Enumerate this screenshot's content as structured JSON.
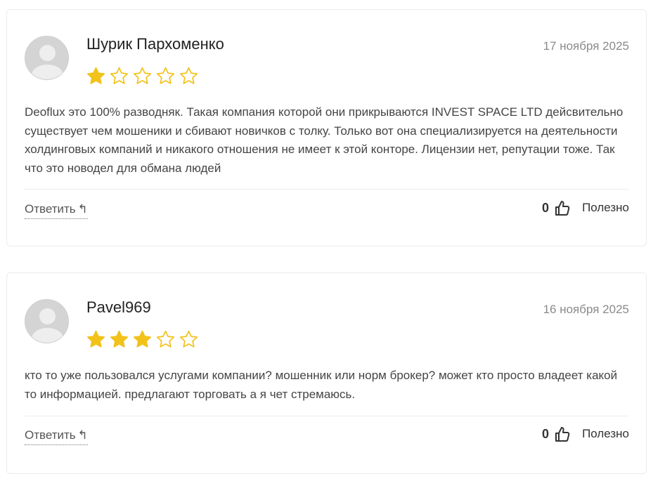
{
  "colors": {
    "star_filled": "#f2c21b",
    "star_outline": "#f2c21b",
    "border": "#ebebeb",
    "date": "#8a8a8a"
  },
  "icons": {
    "avatar": "user-placeholder-icon",
    "star": "star-icon",
    "reply": "reply-arrow-icon",
    "thumb": "thumbs-up-icon"
  },
  "reviews": [
    {
      "author": "Шурик Пархоменко",
      "date": "17 ноября 2025",
      "rating": 1,
      "max_rating": 5,
      "text": "Deoflux это 100% разводняк. Такая компания которой они прикрываются INVEST SPACE LTD дейсвительно существует чем мошеники и сбивают новичков с толку. Только вот она специализируется на деятельности холдинговых компаний и никакого отношения не имеет к этой конторе. Лицензии нет, репутации тоже. Так что это новодел для обмана людей",
      "reply_label": "Ответить",
      "reply_arrow": "↰",
      "helpful_count": "0",
      "helpful_label": "Полезно"
    },
    {
      "author": "Pavel969",
      "date": "16 ноября 2025",
      "rating": 3,
      "max_rating": 5,
      "text": "кто то уже пользовался услугами компании? мошенник или норм брокер? может кто просто владеет какой то информацией. предлагают торговать а я чет стремаюсь.",
      "reply_label": "Ответить",
      "reply_arrow": "↰",
      "helpful_count": "0",
      "helpful_label": "Полезно"
    }
  ]
}
